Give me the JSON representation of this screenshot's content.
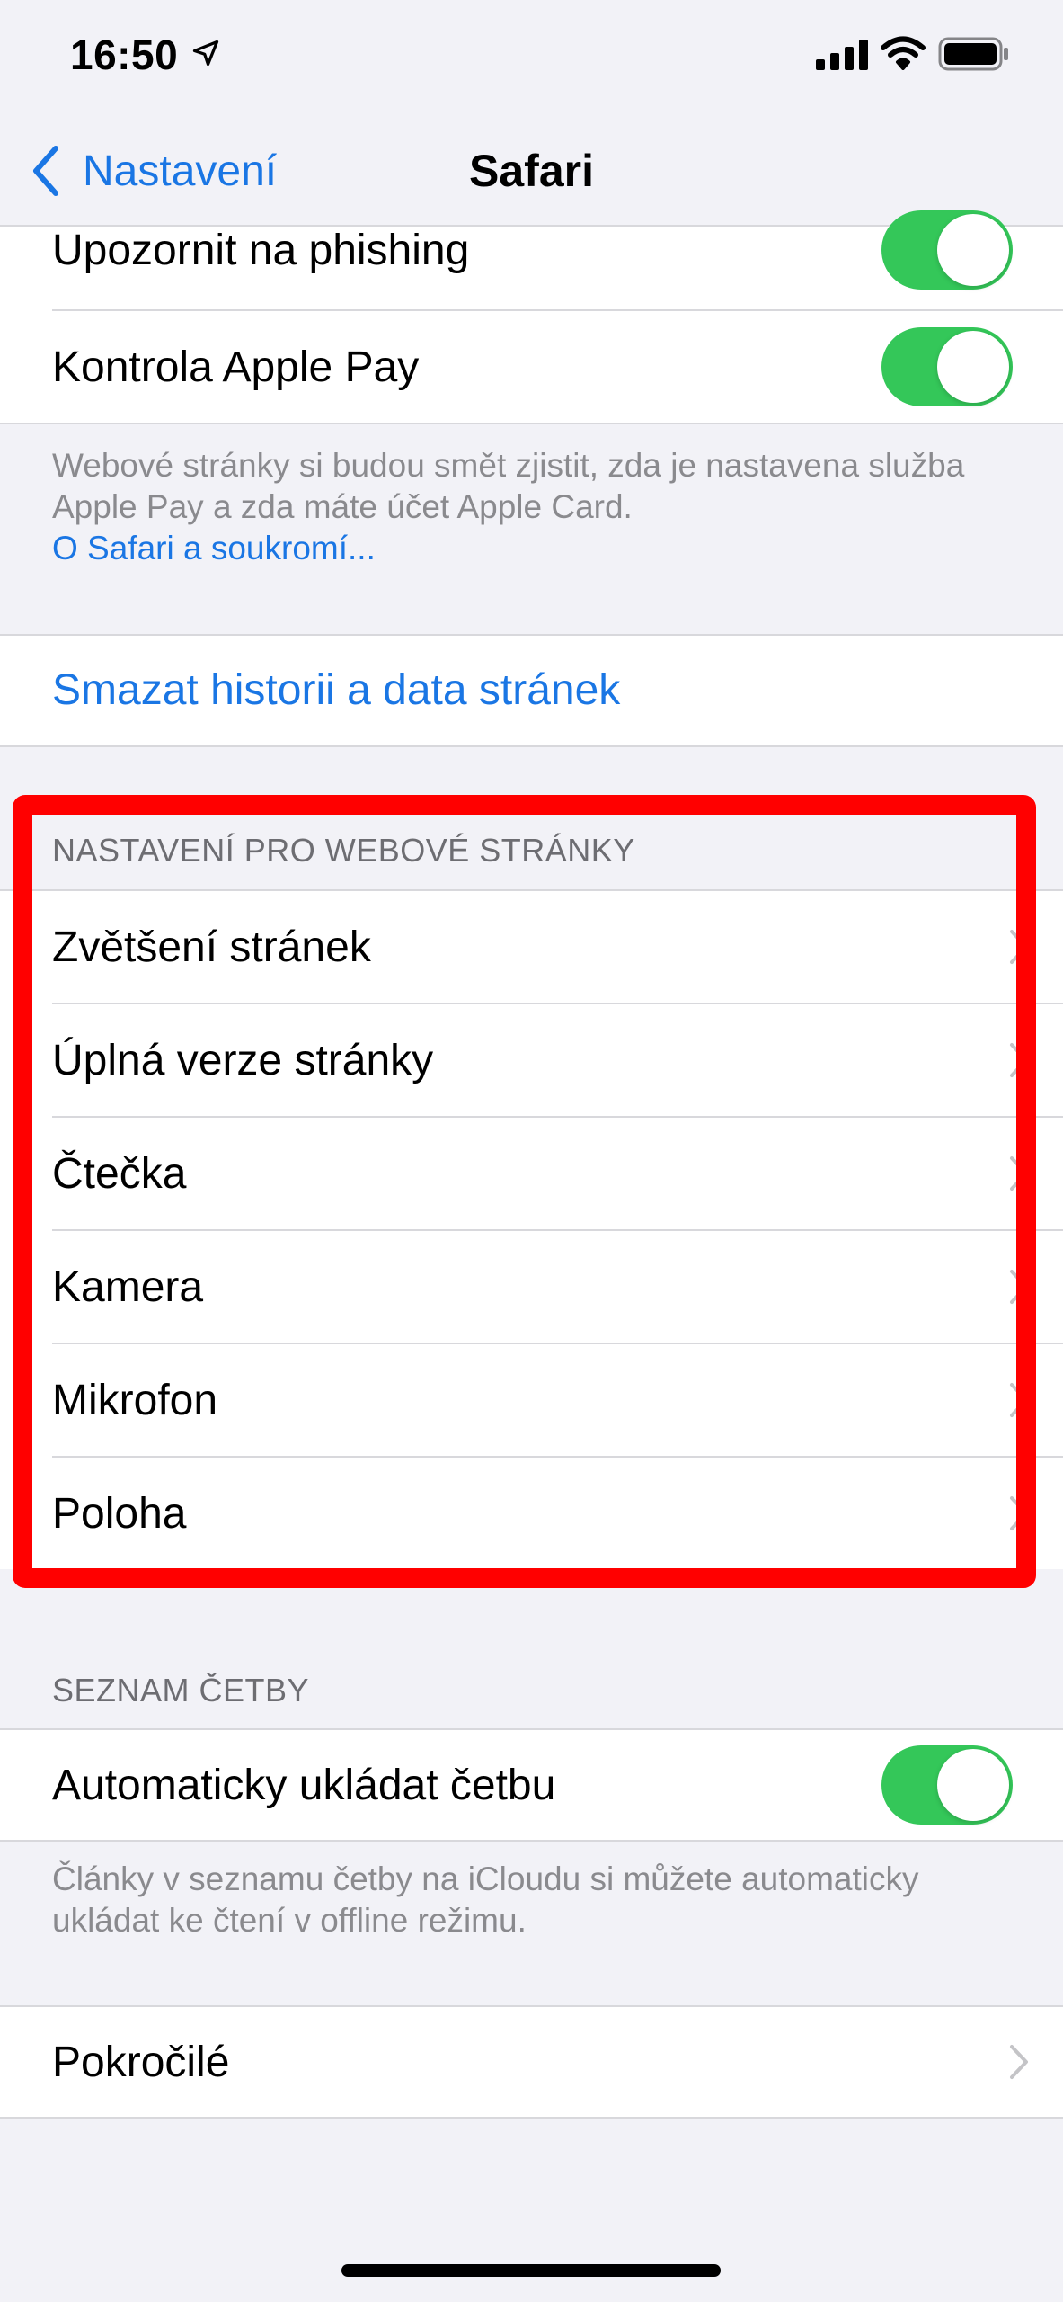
{
  "status_bar": {
    "time": "16:50",
    "icons": [
      "location-arrow-icon",
      "cellular-signal-icon",
      "wifi-icon",
      "battery-icon"
    ]
  },
  "nav": {
    "back_label": "Nastavení",
    "title": "Safari"
  },
  "privacy_group": {
    "rows": [
      {
        "label": "Upozornit na phishing",
        "toggle_on": true
      },
      {
        "label": "Kontrola Apple Pay",
        "toggle_on": true
      }
    ],
    "footer_line1": "Webové stránky si budou smět zjistit, zda je nastavena služba",
    "footer_line2": "Apple Pay a zda máte účet Apple Card.",
    "footer_link": "O Safari a soukromí..."
  },
  "clear_history": {
    "label": "Smazat historii a data stránek"
  },
  "website_settings": {
    "header": "NASTAVENÍ PRO WEBOVÉ STRÁNKY",
    "items": [
      {
        "label": "Zvětšení stránek"
      },
      {
        "label": "Úplná verze stránky"
      },
      {
        "label": "Čtečka"
      },
      {
        "label": "Kamera"
      },
      {
        "label": "Mikrofon"
      },
      {
        "label": "Poloha"
      }
    ]
  },
  "reading_list": {
    "header": "SEZNAM ČETBY",
    "rows": [
      {
        "label": "Automaticky ukládat četbu",
        "toggle_on": true
      }
    ],
    "footer_line1": "Články v seznamu četby na iCloudu si můžete automaticky",
    "footer_line2": "ukládat ke čtení v offline režimu."
  },
  "advanced": {
    "label": "Pokročilé"
  },
  "colors": {
    "accent": "#1a76e4",
    "toggle_on": "#34c759",
    "highlight": "#ff0000",
    "background": "#f2f2f7"
  }
}
